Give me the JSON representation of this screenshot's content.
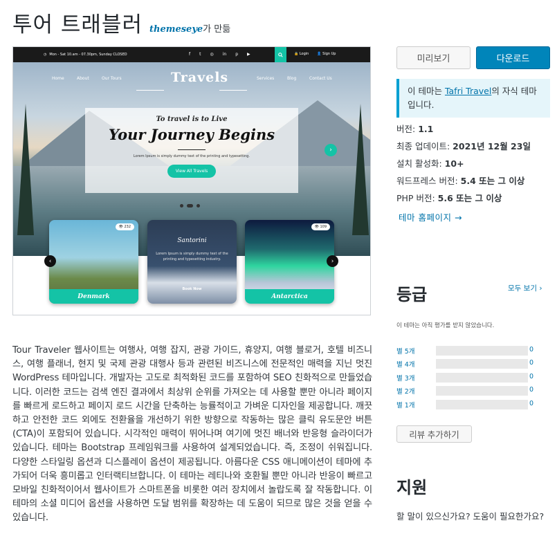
{
  "header": {
    "theme_name": "투어 트래블러",
    "author_name": "themeseye",
    "author_suffix": "가 만듦"
  },
  "preview": {
    "topbar_hours": "Mon - Sat 10.am - 07.30pm, Sunday CLOSED",
    "topbar_login": "Login",
    "topbar_signup": "Sign Up",
    "nav_left": [
      "Home",
      "About",
      "Our Tours"
    ],
    "nav_right": [
      "Services",
      "Blog",
      "Contact Us"
    ],
    "logo": "Travels",
    "kicker": "To travel is to Live",
    "headline": "Your Journey Begins",
    "subline": "Lorem Ipsum is simply dummy text of the printing and typesetting.",
    "cta": "View All Travels",
    "cards": [
      {
        "caption": "Denmark",
        "views": "232"
      },
      {
        "caption": "",
        "title": "Santorini",
        "text": "Lorem Ipsum is simply dummy text of the printing and typesetting industry.",
        "book": "Book Now"
      },
      {
        "caption": "Antarctica",
        "views": "109"
      }
    ]
  },
  "description": "Tour Traveler 웹사이트는 여행사, 여행 잡지, 관광 가이드, 휴양지, 여행 블로거, 호텔 비즈니스, 여행 플래너, 현지 및 국제 관광 대행사 등과 관련된 비즈니스에 전문적인 매력을 지닌 멋진 WordPress 테마입니다. 개발자는 고도로 최적화된 코드를 포함하여 SEO 친화적으로 만들었습니다. 이러한 코드는 검색 엔진 결과에서 최상위 순위를 가져오는 데 사용할 뿐만 아니라 페이지를 빠르게 로드하고 페이지 로드 시간을 단축하는 능률적이고 가벼운 디자인을 제공합니다. 깨끗하고 안전한 코드 외에도 전환율을 개선하기 위한 방향으로 작동하는 많은 클릭 유도문안 버튼(CTA)이 포함되어 있습니다. 시각적인 매력이 뛰어나며 여기에 멋진 배너와 반응형 슬라이더가 있습니다. 테마는 Bootstrap 프레임워크를 사용하여 설계되었습니다. 즉, 조정이 쉬워집니다. 다양한 스타일링 옵션과 디스플레이 옵션이 제공됩니다. 아름다운 CSS 애니메이션이 테마에 추가되어 더욱 흥미롭고 인터랙티브합니다. 이 테마는 레티나와 호환될 뿐만 아니라 반응이 빠르고 모바일 친화적이어서 웹사이트가 스마트폰을 비롯한 여러 장치에서 놀랍도록 잘 작동합니다. 이 테마의 소셜 미디어 옵션을 사용하면 도달 범위를 확장하는 데 도움이 되므로 많은 것을 얻을 수 있습니다.",
  "actions": {
    "preview": "미리보기",
    "download": "다운로드"
  },
  "notice": {
    "prefix": "이 테마는 ",
    "parent_link": "Tafri Travel",
    "suffix": "의 자식 테마입니다."
  },
  "meta": [
    {
      "label": "버전: ",
      "value": "1.1"
    },
    {
      "label": "최종 업데이트: ",
      "value": "2021년 12월 23일"
    },
    {
      "label": "설치 활성화: ",
      "value": "10+"
    },
    {
      "label": "워드프레스 버전: ",
      "value": "5.4 또는 그 이상"
    },
    {
      "label": "PHP 버전: ",
      "value": "5.6 또는 그 이상"
    }
  ],
  "homepage_link": "테마 홈페이지 →",
  "ratings": {
    "title": "등급",
    "see_all": "모두 보기",
    "no_ratings": "이 테마는 아직 평가를 받지 않았습니다.",
    "rows": [
      {
        "label": "별 5개",
        "count": "0",
        "fraction": 0
      },
      {
        "label": "별 4개",
        "count": "0",
        "fraction": 0
      },
      {
        "label": "별 3개",
        "count": "0",
        "fraction": 0
      },
      {
        "label": "별 2개",
        "count": "0",
        "fraction": 0
      },
      {
        "label": "별 1개",
        "count": "0",
        "fraction": 0
      }
    ],
    "add_review": "리뷰 추가하기"
  },
  "support": {
    "title": "지원",
    "text": "할 말이 있으신가요? 도움이 필요한가요?"
  },
  "colors": {
    "accent": "#0085ba",
    "link": "#0073aa",
    "preview_accent": "#14c3a6"
  }
}
